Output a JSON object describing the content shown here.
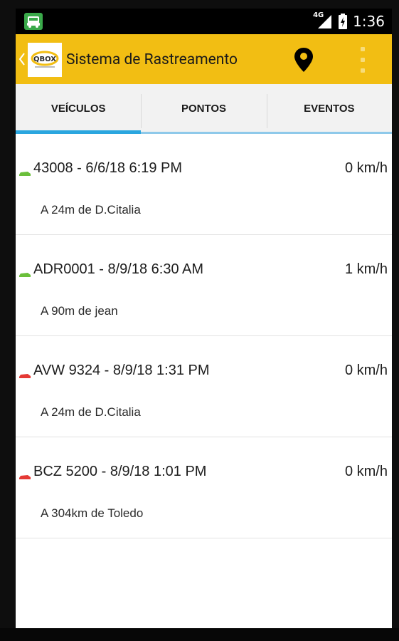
{
  "status_bar": {
    "app_icon": "car-icon",
    "network_label": "4G",
    "signal_icon": "signal-icon",
    "battery_icon": "battery-charging-icon",
    "time": "1:36"
  },
  "app_bar": {
    "back_icon": "chevron-left-icon",
    "logo_icon": "app-logo",
    "title": "Sistema de Rastreamento",
    "map_icon": "map-pin-icon",
    "overflow_icon": "overflow-menu-icon",
    "background_color": "#f2be13"
  },
  "tabs": [
    {
      "label": "VEÍCULOS",
      "active": true
    },
    {
      "label": "PONTOS",
      "active": false
    },
    {
      "label": "EVENTOS",
      "active": false
    }
  ],
  "vehicles": [
    {
      "title": "43008 - 6/6/18 6:19 PM",
      "speed": "0 km/h",
      "location": "A 24m de D.Citalia",
      "status_color": "#6abf3a"
    },
    {
      "title": "ADR0001 - 8/9/18 6:30 AM",
      "speed": "1 km/h",
      "location": "A 90m de jean",
      "status_color": "#6abf3a"
    },
    {
      "title": "AVW 9324 - 8/9/18 1:31 PM",
      "speed": "0 km/h",
      "location": "A 24m de D.Citalia",
      "status_color": "#e53935"
    },
    {
      "title": "BCZ 5200 - 8/9/18 1:01 PM",
      "speed": "0 km/h",
      "location": "A 304km de Toledo",
      "status_color": "#e53935"
    }
  ],
  "colors": {
    "accent_tab": "#2aa6df",
    "vehicle_online": "#6abf3a",
    "vehicle_offline": "#e53935"
  }
}
